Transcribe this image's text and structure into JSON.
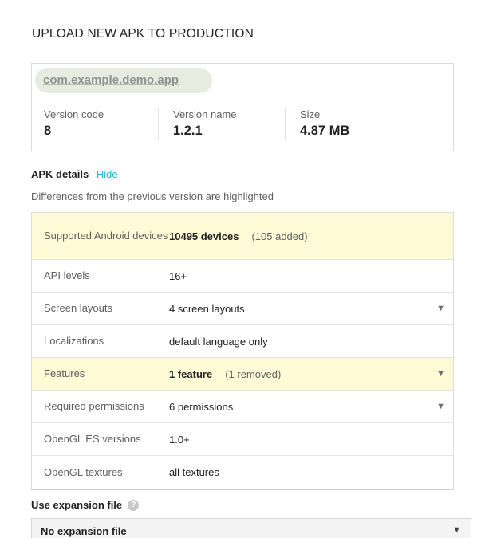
{
  "page": {
    "title": "UPLOAD NEW APK TO PRODUCTION"
  },
  "apk": {
    "package": "com.example.demo.app",
    "version_code_label": "Version code",
    "version_code": "8",
    "version_name_label": "Version name",
    "version_name": "1.2.1",
    "size_label": "Size",
    "size": "4.87 MB"
  },
  "details": {
    "heading": "APK details",
    "hide_link": "Hide",
    "note": "Differences from the previous version are highlighted",
    "rows": [
      {
        "label": "Supported Android devices",
        "value": "10495 devices",
        "extra": "(105 added)",
        "highlighted": true,
        "expandable": false
      },
      {
        "label": "API levels",
        "value": "16+",
        "extra": "",
        "highlighted": false,
        "expandable": false
      },
      {
        "label": "Screen layouts",
        "value": "4 screen layouts",
        "extra": "",
        "highlighted": false,
        "expandable": true
      },
      {
        "label": "Localizations",
        "value": "default language only",
        "extra": "",
        "highlighted": false,
        "expandable": false
      },
      {
        "label": "Features",
        "value": "1 feature",
        "extra": "(1 removed)",
        "highlighted": true,
        "expandable": true
      },
      {
        "label": "Required permissions",
        "value": "6 permissions",
        "extra": "",
        "highlighted": false,
        "expandable": true
      },
      {
        "label": "OpenGL ES versions",
        "value": "1.0+",
        "extra": "",
        "highlighted": false,
        "expandable": false
      },
      {
        "label": "OpenGL textures",
        "value": "all textures",
        "extra": "",
        "highlighted": false,
        "expandable": false
      }
    ]
  },
  "expansion": {
    "heading": "Use expansion file",
    "help_icon": "?",
    "selected": "No expansion file",
    "arrow_icon": "▼"
  },
  "colors": {
    "highlight": "#fefbd6",
    "link": "#2bb2cc"
  }
}
